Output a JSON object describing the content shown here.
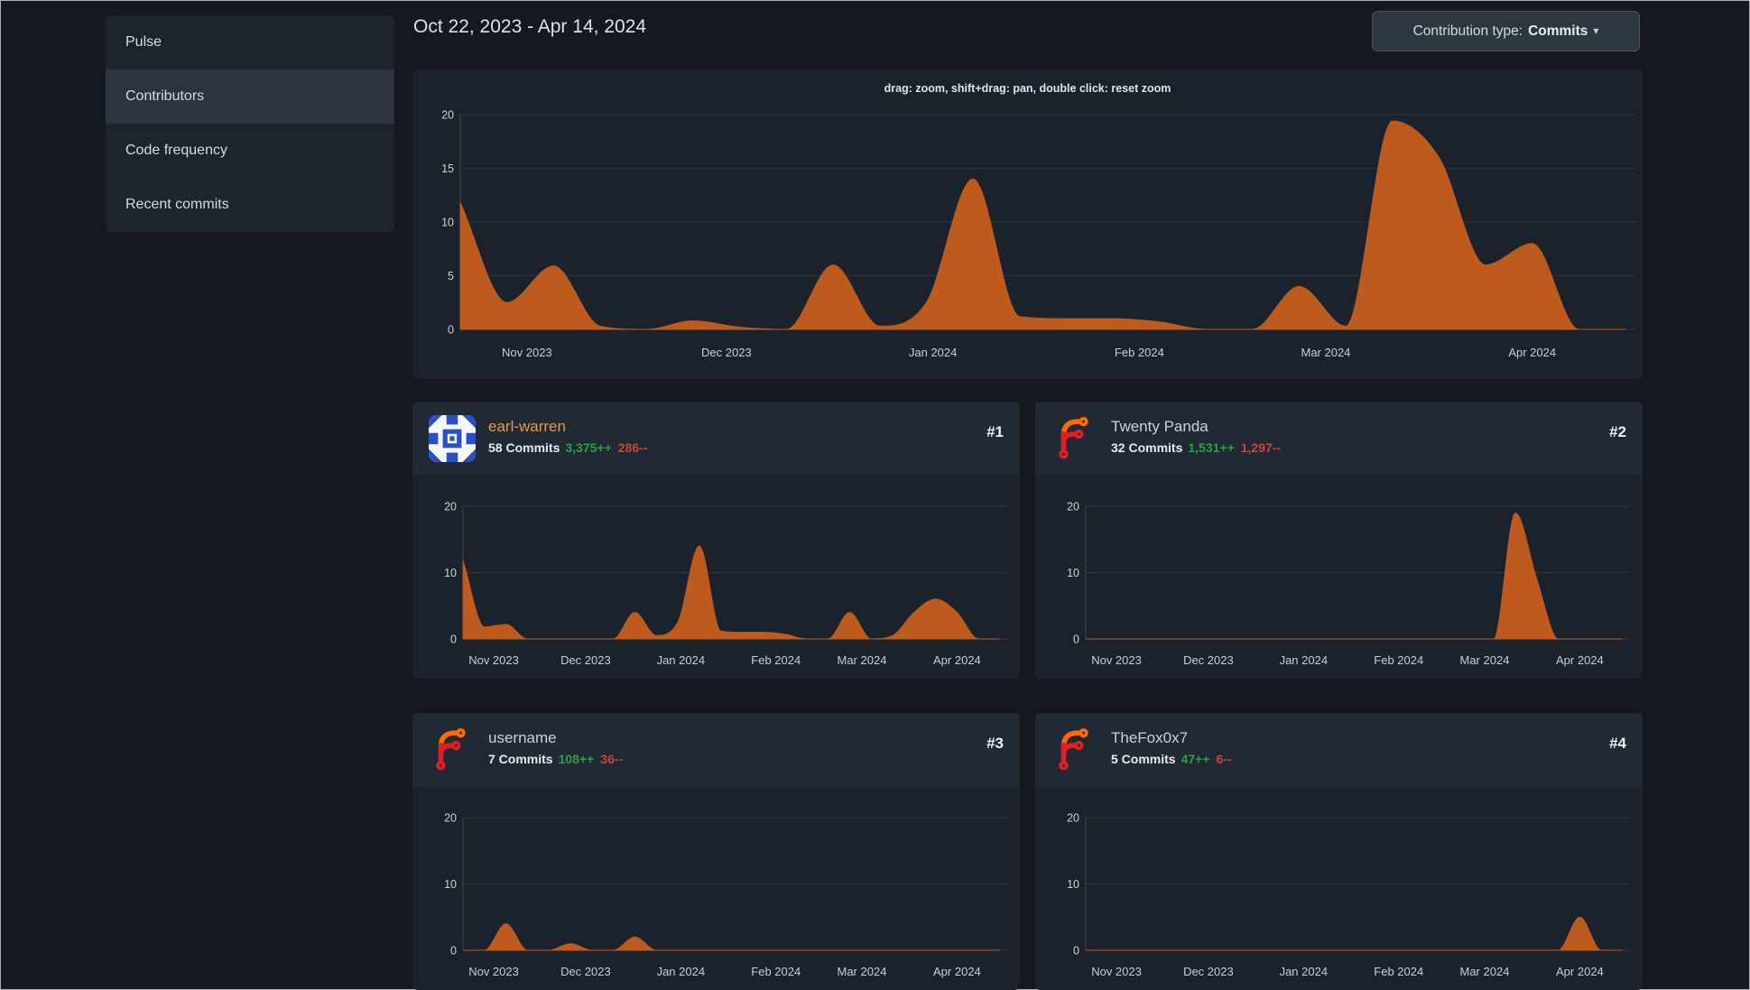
{
  "header": {
    "date_range": "Oct 22, 2023 - Apr 14, 2024"
  },
  "toolbar": {
    "label": "Contribution type:",
    "value": "Commits",
    "caret": "▾"
  },
  "sidebar": {
    "active_index": 1,
    "items": [
      {
        "label": "Pulse"
      },
      {
        "label": "Contributors"
      },
      {
        "label": "Code frequency"
      },
      {
        "label": "Recent commits"
      }
    ]
  },
  "main_chart_hint": "drag: zoom, shift+drag: pan, double click: reset zoom",
  "contributors": [
    {
      "rank": "#1",
      "name": "earl-warren",
      "commits": "58 Commits",
      "additions": "3,375++",
      "deletions": "286--",
      "avatar": "blue-identicon"
    },
    {
      "rank": "#2",
      "name": "Twenty Panda",
      "commits": "32 Commits",
      "additions": "1,531++",
      "deletions": "1,297--",
      "avatar": "forgejo-logo"
    },
    {
      "rank": "#3",
      "name": "username",
      "commits": "7 Commits",
      "additions": "108++",
      "deletions": "36--",
      "avatar": "forgejo-logo"
    },
    {
      "rank": "#4",
      "name": "TheFox0x7",
      "commits": "5 Commits",
      "additions": "47++",
      "deletions": "6--",
      "avatar": "forgejo-logo"
    }
  ],
  "colors": {
    "area_fill": "#bc5b1d",
    "link_orange": "#e9964a",
    "additions_green": "#2f9e49",
    "deletions_red": "#c9443a",
    "identicon_blue": "#2b4fc8",
    "forgejo_orange": "#ff6b00",
    "forgejo_red": "#e01e25",
    "grid_line": "rgba(255,255,255,0.09)",
    "axis_line": "rgba(255,255,255,0.16)",
    "tick_text": "#ccd2d8"
  },
  "chart_data": [
    {
      "id": "main",
      "type": "area",
      "series_name": "Commits per week, all contributors",
      "x_unit": "weeks starting Oct 22 2023",
      "ylim": [
        0,
        20
      ],
      "y_ticks": [
        0,
        5,
        10,
        15,
        20
      ],
      "x_tick_labels": [
        "Nov 2023",
        "Dec 2023",
        "Jan 2024",
        "Feb 2024",
        "Mar 2024",
        "Apr 2024"
      ],
      "x_tick_weeks": [
        1.43,
        5.71,
        10.14,
        14.57,
        18.57,
        23.0
      ],
      "values": [
        11.8,
        2.5,
        5.9,
        0.3,
        0,
        0.8,
        0.2,
        0,
        6,
        0.3,
        2.5,
        14,
        1.2,
        1,
        1,
        0.7,
        0,
        0,
        4,
        0.3,
        19.4,
        16,
        6,
        8,
        0,
        0
      ],
      "legend": "none",
      "grid": true
    },
    {
      "id": "earl-warren",
      "type": "area",
      "series_name": "earl-warren commits per week",
      "ylim": [
        0,
        20
      ],
      "y_ticks": [
        0,
        10,
        20
      ],
      "x_tick_labels": [
        "Nov 2023",
        "Dec 2023",
        "Jan 2024",
        "Feb 2024",
        "Mar 2024",
        "Apr 2024"
      ],
      "x_tick_weeks": [
        1.43,
        5.71,
        10.14,
        14.57,
        18.57,
        23.0
      ],
      "values": [
        11.8,
        1.8,
        2.2,
        0,
        0,
        0,
        0,
        0,
        4,
        0.5,
        2.5,
        14,
        1.2,
        1,
        1,
        0.7,
        0,
        0,
        4,
        0,
        0.5,
        4,
        6,
        4,
        0,
        0
      ],
      "legend": "none",
      "grid": true
    },
    {
      "id": "twenty-panda",
      "type": "area",
      "series_name": "Twenty Panda commits per week",
      "ylim": [
        0,
        20
      ],
      "y_ticks": [
        0,
        10,
        20
      ],
      "x_tick_labels": [
        "Nov 2023",
        "Dec 2023",
        "Jan 2024",
        "Feb 2024",
        "Mar 2024",
        "Apr 2024"
      ],
      "x_tick_weeks": [
        1.43,
        5.71,
        10.14,
        14.57,
        18.57,
        23.0
      ],
      "values": [
        0,
        0,
        0,
        0,
        0,
        0,
        0,
        0,
        0,
        0,
        0,
        0,
        0,
        0,
        0,
        0,
        0,
        0,
        0,
        0,
        19,
        9,
        0,
        0,
        0,
        0
      ],
      "legend": "none",
      "grid": true
    },
    {
      "id": "username",
      "type": "area",
      "series_name": "username commits per week",
      "ylim": [
        0,
        20
      ],
      "y_ticks": [
        0,
        10,
        20
      ],
      "x_tick_labels": [
        "Nov 2023",
        "Dec 2023",
        "Jan 2024",
        "Feb 2024",
        "Mar 2024",
        "Apr 2024"
      ],
      "x_tick_weeks": [
        1.43,
        5.71,
        10.14,
        14.57,
        18.57,
        23.0
      ],
      "values": [
        0,
        0,
        4,
        0,
        0,
        1,
        0,
        0,
        2,
        0,
        0,
        0,
        0,
        0,
        0,
        0,
        0,
        0,
        0,
        0,
        0,
        0,
        0,
        0,
        0,
        0
      ],
      "legend": "none",
      "grid": true
    },
    {
      "id": "thefox0x7",
      "type": "area",
      "series_name": "TheFox0x7 commits per week",
      "ylim": [
        0,
        20
      ],
      "y_ticks": [
        0,
        10,
        20
      ],
      "x_tick_labels": [
        "Nov 2023",
        "Dec 2023",
        "Jan 2024",
        "Feb 2024",
        "Mar 2024",
        "Apr 2024"
      ],
      "x_tick_weeks": [
        1.43,
        5.71,
        10.14,
        14.57,
        18.57,
        23.0
      ],
      "values": [
        0,
        0,
        0,
        0,
        0,
        0,
        0,
        0,
        0,
        0,
        0,
        0,
        0,
        0,
        0,
        0,
        0,
        0,
        0,
        0,
        0,
        0,
        0,
        5,
        0,
        0
      ],
      "legend": "none",
      "grid": true
    }
  ]
}
